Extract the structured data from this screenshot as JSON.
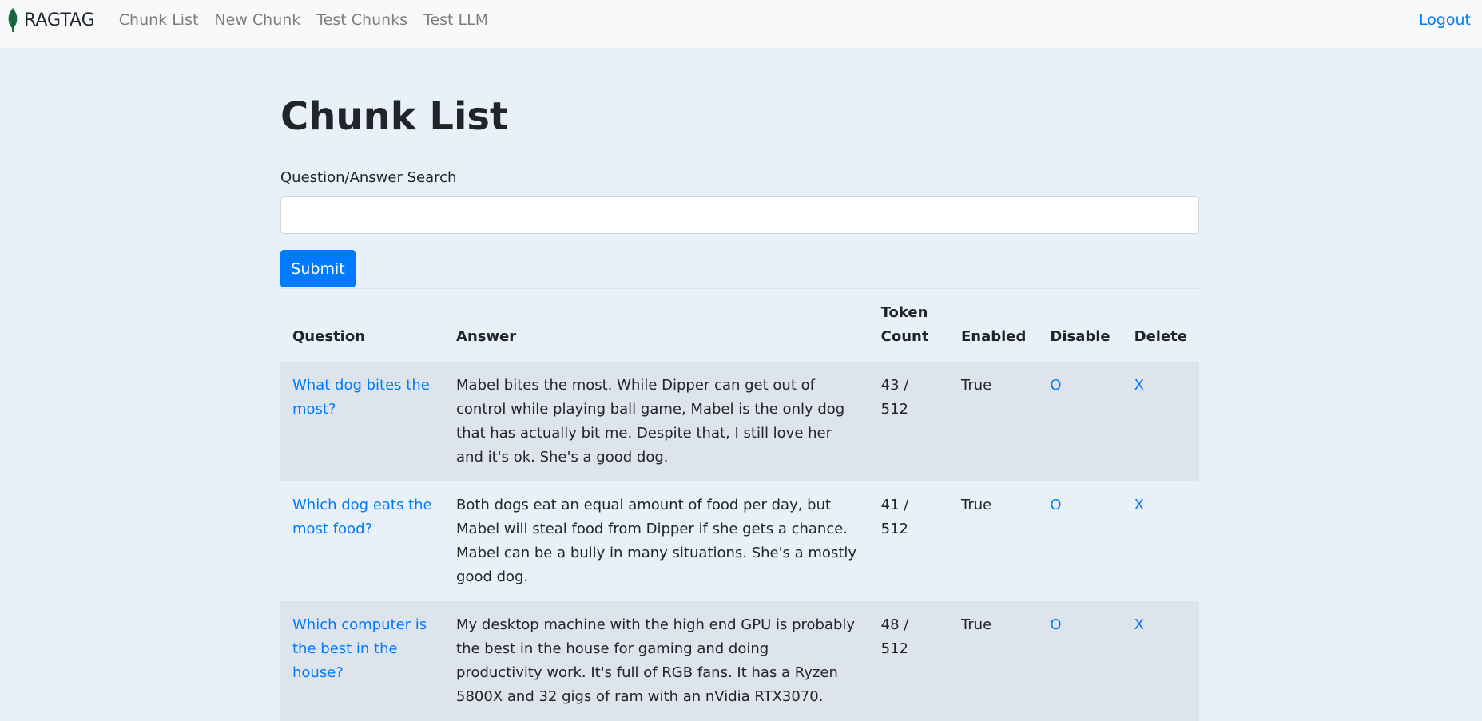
{
  "navbar": {
    "brand": "RAGTAG",
    "brand_icon": "leaf-icon",
    "brand_color": "#1a6b43",
    "links": [
      "Chunk List",
      "New Chunk",
      "Test Chunks",
      "Test LLM"
    ],
    "logout": "Logout"
  },
  "page": {
    "title": "Chunk List",
    "search_label": "Question/Answer Search",
    "search_value": "",
    "submit_label": "Submit"
  },
  "table": {
    "headers": [
      "Question",
      "Answer",
      "Token Count",
      "Enabled",
      "Disable",
      "Delete"
    ],
    "rows": [
      {
        "question": "What dog bites the most?",
        "answer": "Mabel bites the most. While Dipper can get out of control while playing ball game, Mabel is the only dog that has actually bit me. Despite that, I still love her and it's ok. She's a good dog.",
        "token_count": "43 / 512",
        "enabled": "True",
        "disable": "O",
        "delete": "X"
      },
      {
        "question": "Which dog eats the most food?",
        "answer": "Both dogs eat an equal amount of food per day, but Mabel will steal food from Dipper if she gets a chance. Mabel can be a bully in many situations. She's a mostly good dog.",
        "token_count": "41 / 512",
        "enabled": "True",
        "disable": "O",
        "delete": "X"
      },
      {
        "question": "Which computer is the best in the house?",
        "answer": "My desktop machine with the high end GPU is probably the best in the house for gaming and doing productivity work. It's full of RGB fans. It has a Ryzen 5800X and 32 gigs of ram with an nVidia RTX3070.",
        "token_count": "48 / 512",
        "enabled": "True",
        "disable": "O",
        "delete": "X"
      }
    ]
  },
  "colors": {
    "accent": "#007bff",
    "page_bg": "#e8f0f8",
    "navbar_bg": "#f8f9fa",
    "stripe_bg": "#dee4ec"
  }
}
